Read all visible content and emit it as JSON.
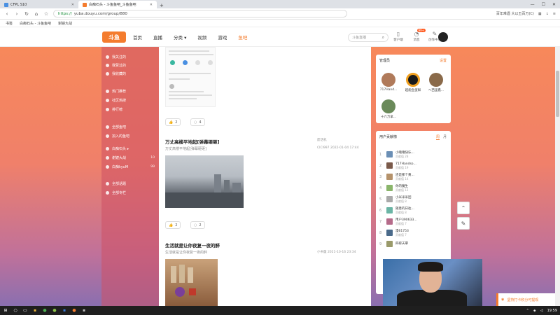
{
  "browser": {
    "tabs": [
      {
        "label": "CFPL S10",
        "active": false
      },
      {
        "label": "白痴石头 - 斗鱼鱼吧_斗鱼鱼吧",
        "active": true
      }
    ],
    "new_tab": "+",
    "url_protocol": "https://",
    "url_rest": "yuba.douyu.com/group/880",
    "addr_right_text": "百年难遇  大以五百万(C)",
    "window_controls": [
      "—",
      "☐",
      "✕"
    ]
  },
  "bookmarks": [
    "书签",
    "白痴石头 - 斗鱼鱼吧",
    "谢镜大战"
  ],
  "site": {
    "logo": "斗鱼",
    "nav": [
      {
        "label": "首页",
        "active": false
      },
      {
        "label": "直播",
        "active": false
      },
      {
        "label": "分类 ▾",
        "active": false
      },
      {
        "label": "视频",
        "active": false
      },
      {
        "label": "游戏",
        "active": false
      },
      {
        "label": "鱼吧",
        "active": true
      }
    ],
    "search_placeholder": "斗鱼直播",
    "header_icons": [
      {
        "label": "客户端",
        "icon": "phone-icon",
        "badge": ""
      },
      {
        "label": "消息",
        "icon": "bell-icon",
        "badge": "99+"
      },
      {
        "label": "创作中心",
        "icon": "pencil-icon",
        "badge": ""
      }
    ]
  },
  "sidebar": {
    "items": [
      {
        "label": "我关注的",
        "count": ""
      },
      {
        "label": "我赞过的",
        "count": ""
      },
      {
        "label": "我收藏的",
        "count": ""
      },
      {
        "label": "热门推荐",
        "count": ""
      },
      {
        "label": "社区热搜",
        "count": ""
      },
      {
        "label": "排行榜",
        "count": ""
      },
      {
        "label": "全部鱼吧",
        "count": ""
      },
      {
        "label": "加入的鱼吧",
        "count": ""
      },
      {
        "label": "白痴石头 ▸",
        "count": ""
      },
      {
        "label": "谢镜大战",
        "count": "10"
      },
      {
        "label": "白痴kyuM",
        "count": "99"
      },
      {
        "label": "全部话题",
        "count": ""
      },
      {
        "label": "全部专栏",
        "count": ""
      }
    ]
  },
  "posts": [
    {
      "likes": "2",
      "comments": "4"
    },
    {
      "title": "万丈高楼平地起[弹幕砸砸]",
      "sub": "万丈高楼平地起[弹幕砸砸]",
      "author": "废话机",
      "source": "CICI997",
      "time": "2022-01-04 17:44",
      "likes": "2",
      "comments": "2"
    },
    {
      "title": "生活就是让你夜复一夜的醉",
      "sub": "生活就是让你夜复一夜的醉",
      "author": "小书童",
      "time": "2021-10-16 23:34"
    }
  ],
  "managers": {
    "title": "管理员",
    "link": "设置",
    "people": [
      {
        "name": "717Hand...",
        "color": "#b07a5a"
      },
      {
        "name": "超能鱼蛋鲜",
        "color": "#1a1a1a"
      },
      {
        "name": "ヘ西里鑫...",
        "color": "#8a6a4a"
      },
      {
        "name": "十六万拿...",
        "color": "#6a8a5a"
      }
    ]
  },
  "ranking": {
    "title": "用户贡献榜",
    "tabs": [
      "周",
      "月"
    ],
    "rows": [
      {
        "num": "1",
        "name": "小嘻嘻快乐...",
        "level": "贡献值 28"
      },
      {
        "num": "2",
        "name": "717Handso...",
        "level": "贡献值 19"
      },
      {
        "num": "3",
        "name": "还是那个黄...",
        "level": "贡献值 14"
      },
      {
        "num": "4",
        "name": "你的魔生",
        "level": "贡献值 12"
      },
      {
        "num": "5",
        "name": "小米米米团",
        "level": "贡献值 8"
      },
      {
        "num": "6",
        "name": "随意的日往...",
        "level": "贡献值 8"
      },
      {
        "num": "7",
        "name": "用户390633...",
        "level": "贡献值 7"
      },
      {
        "num": "8",
        "name": "漫61753",
        "level": "贡献值 7"
      },
      {
        "num": "9",
        "name": "四碎天覃",
        "level": ""
      }
    ]
  },
  "toast": "坚持打卡积分可提现",
  "taskbar": {
    "clock": "19:59"
  }
}
